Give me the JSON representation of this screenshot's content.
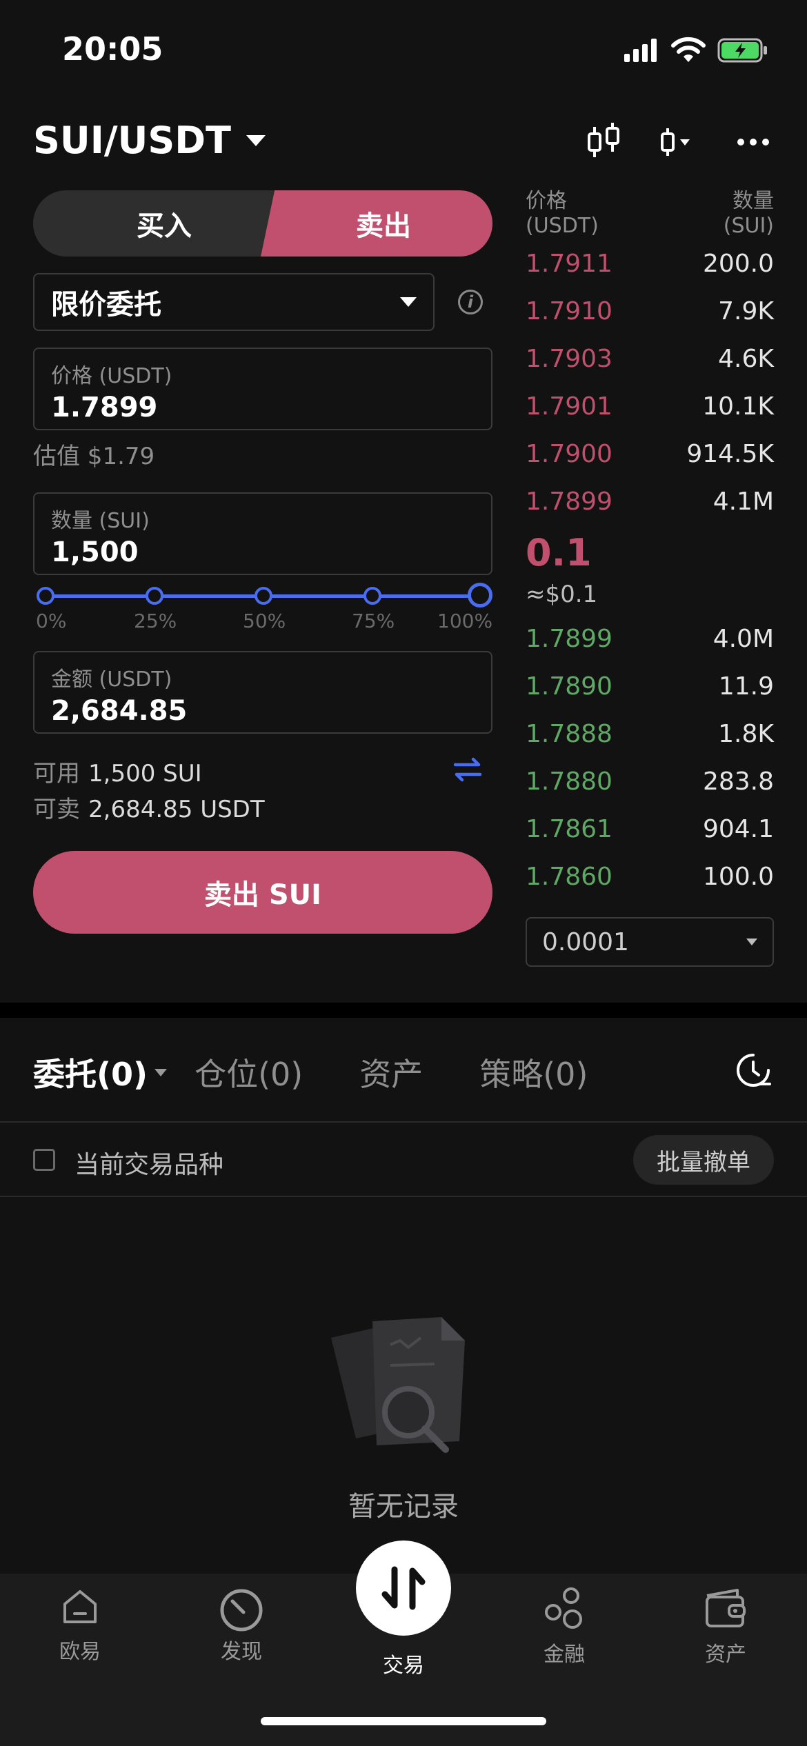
{
  "status_bar": {
    "time": "20:05"
  },
  "header": {
    "pair": "SUI/USDT"
  },
  "trade": {
    "buy_label": "买入",
    "sell_label": "卖出",
    "order_type": "限价委托",
    "price_label": "价格 (USDT)",
    "price_value": "1.7899",
    "estimate": "估值 $1.79",
    "qty_label": "数量 (SUI)",
    "qty_value": "1,500",
    "slider_value_pct": 100,
    "slider_ticks": [
      "0%",
      "25%",
      "50%",
      "75%",
      "100%"
    ],
    "amount_label": "金额 (USDT)",
    "amount_value": "2,684.85",
    "available_key": "可用",
    "available_value": "1,500 SUI",
    "sellable_key": "可卖",
    "sellable_value": "2,684.85 USDT",
    "submit_label": "卖出 SUI"
  },
  "orderbook": {
    "price_header_1": "价格",
    "price_header_2": "(USDT)",
    "qty_header_1": "数量",
    "qty_header_2": "(SUI)",
    "asks": [
      {
        "price": "1.7911",
        "qty": "200.0"
      },
      {
        "price": "1.7910",
        "qty": "7.9K"
      },
      {
        "price": "1.7903",
        "qty": "4.6K"
      },
      {
        "price": "1.7901",
        "qty": "10.1K"
      },
      {
        "price": "1.7900",
        "qty": "914.5K"
      },
      {
        "price": "1.7899",
        "qty": "4.1M"
      }
    ],
    "mid_price": "0.1",
    "mid_usd": "≈$0.1",
    "bids": [
      {
        "price": "1.7899",
        "qty": "4.0M"
      },
      {
        "price": "1.7890",
        "qty": "11.9"
      },
      {
        "price": "1.7888",
        "qty": "1.8K"
      },
      {
        "price": "1.7880",
        "qty": "283.8"
      },
      {
        "price": "1.7861",
        "qty": "904.1"
      },
      {
        "price": "1.7860",
        "qty": "100.0"
      }
    ],
    "precision": "0.0001"
  },
  "orders": {
    "tabs": [
      "委托(0)",
      "仓位(0)",
      "资产",
      "策略(0)"
    ],
    "filter_label": "当前交易品种",
    "batch_cancel": "批量撤单",
    "empty_text": "暂无记录"
  },
  "nav": {
    "items": [
      "欧易",
      "发现",
      "交易",
      "金融",
      "资产"
    ]
  },
  "colors": {
    "sell": "#c0506d",
    "buy": "#5fa865",
    "accent": "#4a6cf0",
    "background": "#121212"
  }
}
